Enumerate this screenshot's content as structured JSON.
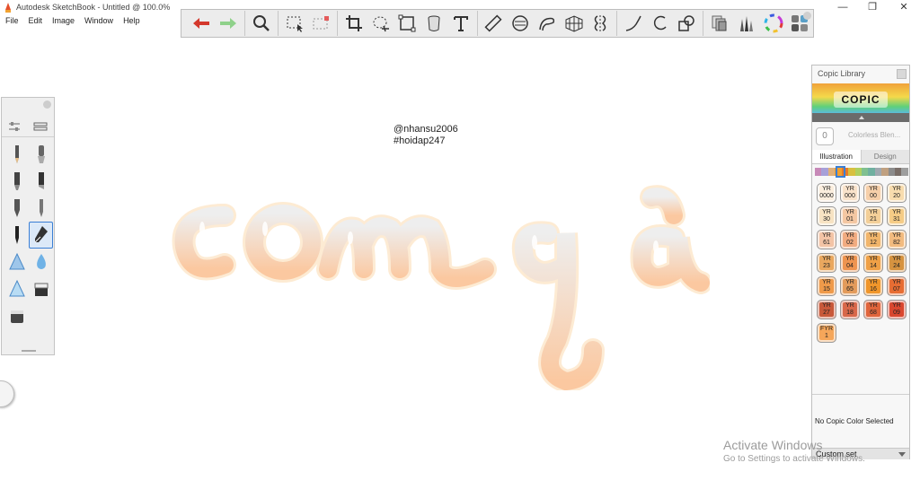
{
  "window": {
    "title": "Autodesk SketchBook - Untitled @ 100.0%",
    "minimize": "—",
    "restore": "❐",
    "close": "✕"
  },
  "menu": [
    "File",
    "Edit",
    "Image",
    "Window",
    "Help"
  ],
  "toolbar": {
    "tools": [
      "undo",
      "redo",
      "zoom",
      "select",
      "transform-select",
      "crop",
      "lasso",
      "distort",
      "bucket",
      "text",
      "ruler",
      "ellipse",
      "french-curve",
      "perspective",
      "symmetry",
      "stroke",
      "circle",
      "shape",
      "layer",
      "brushes",
      "color-wheel",
      "copic"
    ]
  },
  "canvas": {
    "credit_line1": "@nhansu2006",
    "credit_line2": "#hoidap247"
  },
  "copic": {
    "title": "Copic Library",
    "logo": "COPIC",
    "colorless_value": "0",
    "colorless_label": "Colorless Blen...",
    "tabs": [
      "Illustration",
      "Design"
    ],
    "strip_colors": [
      "#c789b8",
      "#a7a0d8",
      "#e0b07a",
      "#f0a030",
      "#e67a2a",
      "#d8c040",
      "#b0d060",
      "#80c090",
      "#70b0a0",
      "#a0a8b0",
      "#c0a080",
      "#8c8c8c",
      "#7a6e68",
      "#9e9e9e"
    ],
    "swatches": [
      {
        "code1": "YR",
        "code2": "0000",
        "color": "#fbeede"
      },
      {
        "code1": "YR",
        "code2": "000",
        "color": "#f9e2ca"
      },
      {
        "code1": "YR",
        "code2": "00",
        "color": "#f6cfa9"
      },
      {
        "code1": "YR",
        "code2": "20",
        "color": "#f8dcae"
      },
      {
        "code1": "YR",
        "code2": "30",
        "color": "#f7e3c3"
      },
      {
        "code1": "YR",
        "code2": "01",
        "color": "#f4c7a2"
      },
      {
        "code1": "YR",
        "code2": "21",
        "color": "#f3cf98"
      },
      {
        "code1": "YR",
        "code2": "31",
        "color": "#f5cc86"
      },
      {
        "code1": "YR",
        "code2": "61",
        "color": "#f3c4a6"
      },
      {
        "code1": "YR",
        "code2": "02",
        "color": "#f1ab80"
      },
      {
        "code1": "YR",
        "code2": "12",
        "color": "#f1b56b"
      },
      {
        "code1": "YR",
        "code2": "82",
        "color": "#f2bb7f"
      },
      {
        "code1": "YR",
        "code2": "23",
        "color": "#eaa85f"
      },
      {
        "code1": "YR",
        "code2": "04",
        "color": "#ee9450"
      },
      {
        "code1": "YR",
        "code2": "14",
        "color": "#efa046"
      },
      {
        "code1": "YR",
        "code2": "24",
        "color": "#d69340"
      },
      {
        "code1": "YR",
        "code2": "15",
        "color": "#ef9a4a"
      },
      {
        "code1": "YR",
        "code2": "65",
        "color": "#e39b5b"
      },
      {
        "code1": "YR",
        "code2": "16",
        "color": "#f0962b"
      },
      {
        "code1": "YR",
        "code2": "07",
        "color": "#e76d33"
      },
      {
        "code1": "YR",
        "code2": "27",
        "color": "#c8593a"
      },
      {
        "code1": "YR",
        "code2": "18",
        "color": "#d8684a"
      },
      {
        "code1": "YR",
        "code2": "68",
        "color": "#e0653c"
      },
      {
        "code1": "YR",
        "code2": "09",
        "color": "#d9472f"
      },
      {
        "code1": "FYR",
        "code2": "1",
        "color": "#f5a65a"
      }
    ],
    "status": "No Copic Color Selected",
    "set_label": "Custom set"
  },
  "watermark": {
    "title": "Activate Windows",
    "subtitle": "Go to Settings to activate Windows."
  },
  "colors": {
    "accent": "#3a7fd5",
    "undo_red": "#d4382c",
    "redo_green": "#8fd18a",
    "art_peach": "#f9c9a3"
  }
}
